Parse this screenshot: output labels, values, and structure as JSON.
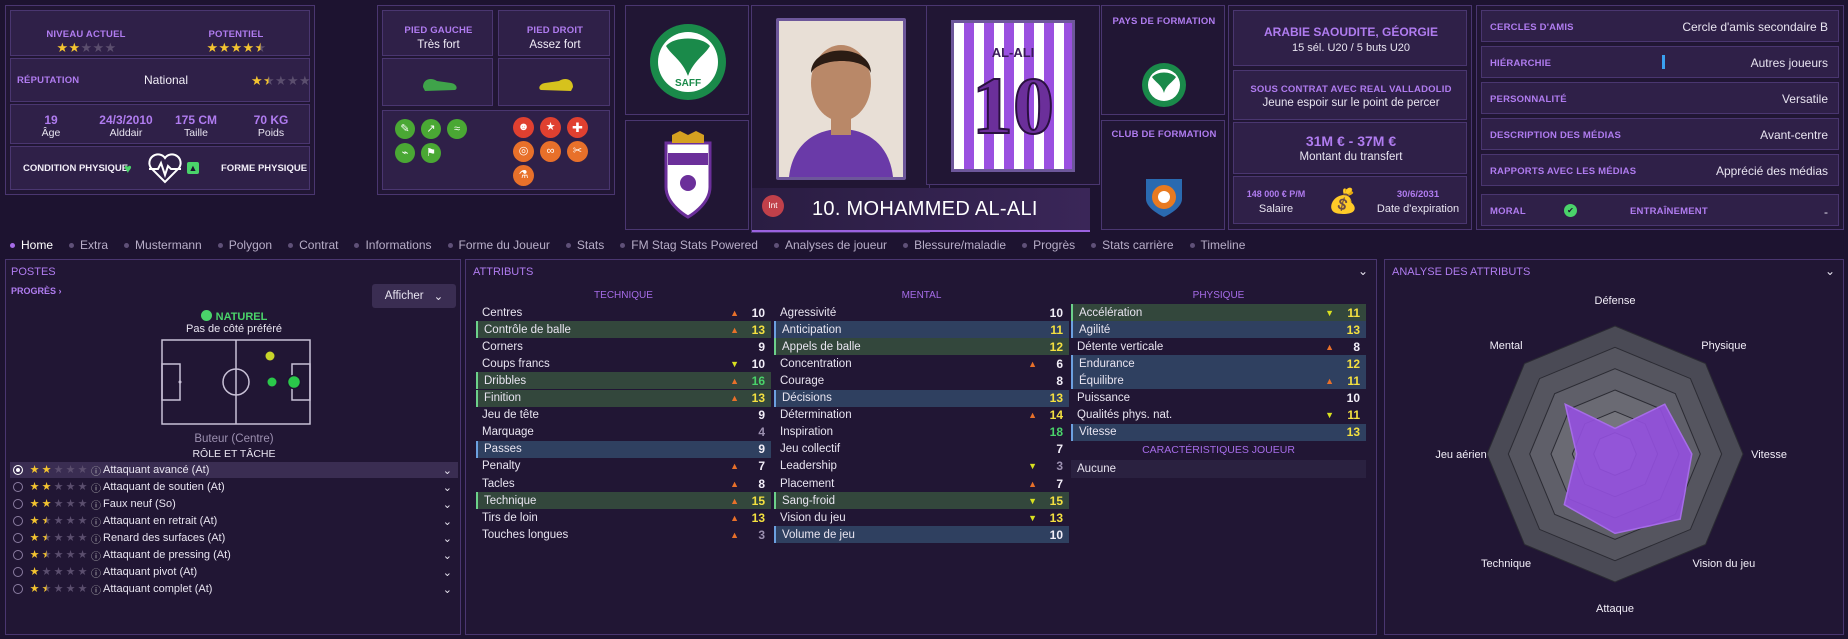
{
  "top": {
    "current_level_label": "NIVEAU ACTUEL",
    "current_level_stars": 2,
    "potential_label": "POTENTIEL",
    "potential_stars": 4.5,
    "reputation_label": "RÉPUTATION",
    "reputation_value": "National",
    "reputation_stars": 1.5,
    "age_value": "19",
    "age_label": "Âge",
    "dob_value": "24/3/2010",
    "dob_label": "Alddair",
    "height_value": "175 CM",
    "height_label": "Taille",
    "weight_value": "70 KG",
    "weight_label": "Poids",
    "condition_label": "CONDITION PHYSIQUE",
    "form_label": "FORME PHYSIQUE",
    "left_foot_label": "PIED GAUCHE",
    "left_foot_value": "Très fort",
    "right_foot_label": "PIED DROIT",
    "right_foot_value": "Assez fort",
    "shirt_name": "AL-ALI",
    "shirt_number": "10",
    "player_name": "10. MOHAMMED AL-ALI",
    "int_badge": "Int",
    "training_country_label": "PAYS DE FORMATION",
    "training_club_label": "CLUB DE FORMATION",
    "nation_title": "ARABIE SAOUDITE, GÉORGIE",
    "nation_caps": "15 sél. U20 / 5 buts U20",
    "contract_title": "SOUS CONTRAT AVEC REAL VALLADOLID",
    "contract_value": "Jeune espoir sur le point de percer",
    "transfer_value": "31M € - 37M €",
    "transfer_label": "Montant du transfert",
    "salary_value": "148 000 € P/M",
    "salary_label": "Salaire",
    "expiry_value": "30/6/2031",
    "expiry_label": "Date d'expiration",
    "right_rows": [
      {
        "label": "CERCLES D'AMIS",
        "value": "Cercle d'amis secondaire B"
      },
      {
        "label": "HIÉRARCHIE",
        "value": "Autres joueurs"
      },
      {
        "label": "PERSONNALITÉ",
        "value": "Versatile"
      },
      {
        "label": "DESCRIPTION DES MÉDIAS",
        "value": "Avant-centre"
      },
      {
        "label": "RAPPORTS AVEC LES MÉDIAS",
        "value": "Apprécié des médias"
      }
    ],
    "morale_label": "MORAL",
    "training_label": "ENTRAÎNEMENT",
    "training_value": "-"
  },
  "tabs": [
    "Home",
    "Extra",
    "Mustermann",
    "Polygon",
    "Contrat",
    "Informations",
    "Forme du Joueur",
    "Stats",
    "FM Stag Stats Powered",
    "Analyses de joueur",
    "Blessure/maladie",
    "Progrès",
    "Stats carrière",
    "Timeline"
  ],
  "positions": {
    "title": "POSTES",
    "progress_link": "PROGRÈS",
    "show_button": "Afficher",
    "natural_label": "NATUREL",
    "side_label": "Pas de côté préféré",
    "position_name": "Buteur (Centre)",
    "role_title": "RÔLE ET TÂCHE",
    "roles": [
      {
        "name": "Attaquant avancé (At)",
        "stars": 2
      },
      {
        "name": "Attaquant de soutien (At)",
        "stars": 2
      },
      {
        "name": "Faux neuf (So)",
        "stars": 2
      },
      {
        "name": "Attaquant en retrait (At)",
        "stars": 1.5
      },
      {
        "name": "Renard des surfaces (At)",
        "stars": 1.5
      },
      {
        "name": "Attaquant de pressing (At)",
        "stars": 1.5
      },
      {
        "name": "Attaquant pivot (At)",
        "stars": 1
      },
      {
        "name": "Attaquant complet (At)",
        "stars": 1.5
      }
    ]
  },
  "attributes": {
    "title": "ATTRIBUTS",
    "tech_header": "TECHNIQUE",
    "mental_header": "MENTAL",
    "phys_header": "PHYSIQUE",
    "technique": [
      {
        "name": "Centres",
        "value": "10",
        "arrow": "up",
        "hl": ""
      },
      {
        "name": "Contrôle de balle",
        "value": "13",
        "arrow": "up",
        "hl": "g"
      },
      {
        "name": "Corners",
        "value": "9",
        "arrow": "",
        "hl": ""
      },
      {
        "name": "Coups francs",
        "value": "10",
        "arrow": "down",
        "hl": ""
      },
      {
        "name": "Dribbles",
        "value": "16",
        "arrow": "up",
        "hl": "g"
      },
      {
        "name": "Finition",
        "value": "13",
        "arrow": "up",
        "hl": "g"
      },
      {
        "name": "Jeu de tête",
        "value": "9",
        "arrow": "",
        "hl": ""
      },
      {
        "name": "Marquage",
        "value": "4",
        "arrow": "",
        "hl": ""
      },
      {
        "name": "Passes",
        "value": "9",
        "arrow": "",
        "hl": "b"
      },
      {
        "name": "Penalty",
        "value": "7",
        "arrow": "up",
        "hl": ""
      },
      {
        "name": "Tacles",
        "value": "8",
        "arrow": "up",
        "hl": ""
      },
      {
        "name": "Technique",
        "value": "15",
        "arrow": "up",
        "hl": "g"
      },
      {
        "name": "Tirs de loin",
        "value": "13",
        "arrow": "up",
        "hl": ""
      },
      {
        "name": "Touches longues",
        "value": "3",
        "arrow": "up",
        "hl": ""
      }
    ],
    "mental": [
      {
        "name": "Agressivité",
        "value": "10",
        "arrow": "",
        "hl": ""
      },
      {
        "name": "Anticipation",
        "value": "11",
        "arrow": "",
        "hl": "b"
      },
      {
        "name": "Appels de balle",
        "value": "12",
        "arrow": "",
        "hl": "g"
      },
      {
        "name": "Concentration",
        "value": "6",
        "arrow": "up",
        "hl": ""
      },
      {
        "name": "Courage",
        "value": "8",
        "arrow": "",
        "hl": ""
      },
      {
        "name": "Décisions",
        "value": "13",
        "arrow": "",
        "hl": "b"
      },
      {
        "name": "Détermination",
        "value": "14",
        "arrow": "up",
        "hl": ""
      },
      {
        "name": "Inspiration",
        "value": "18",
        "arrow": "",
        "hl": ""
      },
      {
        "name": "Jeu collectif",
        "value": "7",
        "arrow": "",
        "hl": ""
      },
      {
        "name": "Leadership",
        "value": "3",
        "arrow": "down",
        "hl": ""
      },
      {
        "name": "Placement",
        "value": "7",
        "arrow": "up",
        "hl": ""
      },
      {
        "name": "Sang-froid",
        "value": "15",
        "arrow": "down",
        "hl": "g"
      },
      {
        "name": "Vision du jeu",
        "value": "13",
        "arrow": "down",
        "hl": ""
      },
      {
        "name": "Volume de jeu",
        "value": "10",
        "arrow": "",
        "hl": "b"
      }
    ],
    "physique": [
      {
        "name": "Accélération",
        "value": "11",
        "arrow": "down",
        "hl": "g"
      },
      {
        "name": "Agilité",
        "value": "13",
        "arrow": "",
        "hl": "b"
      },
      {
        "name": "Détente verticale",
        "value": "8",
        "arrow": "up",
        "hl": ""
      },
      {
        "name": "Endurance",
        "value": "12",
        "arrow": "",
        "hl": "b"
      },
      {
        "name": "Équilibre",
        "value": "11",
        "arrow": "up",
        "hl": "b"
      },
      {
        "name": "Puissance",
        "value": "10",
        "arrow": "",
        "hl": ""
      },
      {
        "name": "Qualités phys. nat.",
        "value": "11",
        "arrow": "down",
        "hl": ""
      },
      {
        "name": "Vitesse",
        "value": "13",
        "arrow": "",
        "hl": "b"
      }
    ],
    "traits_title": "CARACTÉRISTIQUES JOUEUR",
    "traits_value": "Aucune"
  },
  "analysis": {
    "title": "ANALYSE DES ATTRIBUTS",
    "axes": [
      "Défense",
      "Physique",
      "Vitesse",
      "Vision du jeu",
      "Attaque",
      "Technique",
      "Jeu aérien",
      "Mental"
    ],
    "values": [
      0.2,
      0.55,
      0.6,
      0.72,
      0.62,
      0.56,
      0.3,
      0.55
    ]
  }
}
